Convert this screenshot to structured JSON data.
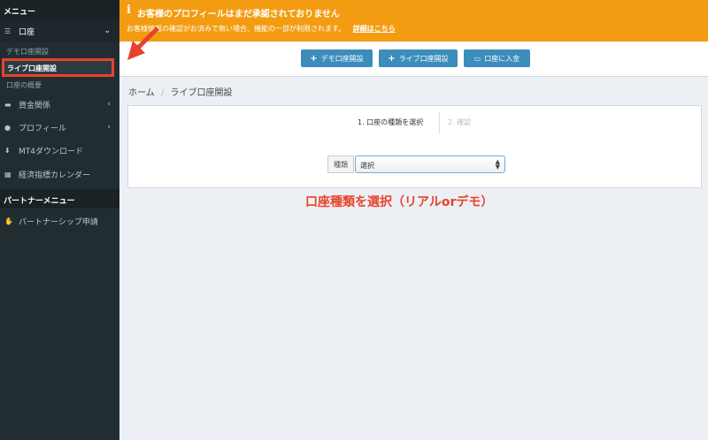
{
  "sidebar": {
    "header": "メニュー",
    "account_label": "口座",
    "sub_items": [
      "デモ口座開設",
      "ライブ口座開設",
      "口座の概要"
    ],
    "items": [
      {
        "label": "資金関係",
        "icon": "wallet-icon"
      },
      {
        "label": "プロフィール",
        "icon": "user-icon"
      },
      {
        "label": "MT4ダウンロード",
        "icon": "download-icon"
      },
      {
        "label": "経済指標カレンダー",
        "icon": "calendar-icon"
      }
    ],
    "partner_header": "パートナーメニュー",
    "partner_item": "パートナーシップ申請"
  },
  "alert": {
    "title": "お客様のプロフィールはまだ承認されておりません",
    "body": "お客様情報の確認がお済みで無い場合、機能の一部が制限されます。",
    "link": "詳細はこちら"
  },
  "buttons": {
    "demo": "デモ口座開設",
    "live": "ライブ口座開設",
    "deposit": "口座に入金"
  },
  "breadcrumb": {
    "home": "ホーム",
    "current": "ライブ口座開設"
  },
  "wizard": {
    "step1": "1. 口座の種類を選択",
    "step2": "2. 確認",
    "field_label": "種類",
    "select_value": "選択"
  },
  "annotation": "口座種類を選択（リアルorデモ）",
  "colors": {
    "sidebar_bg": "#222d32",
    "alert_bg": "#f39c12",
    "button_bg": "#3c8dbc",
    "annotation": "#e8432a"
  }
}
